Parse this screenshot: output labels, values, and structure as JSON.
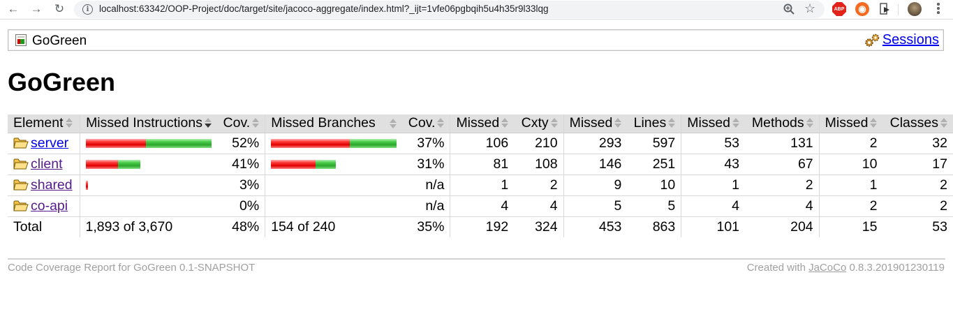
{
  "browser": {
    "url": "localhost:63342/OOP-Project/doc/target/site/jacoco-aggregate/index.html?_ijt=1vfe06pgbqih5u4h35r9l33lqg",
    "ext_abp": "ABP"
  },
  "breadcrumb": {
    "label": "GoGreen",
    "sessions_label": "Sessions"
  },
  "page": {
    "title": "GoGreen"
  },
  "table": {
    "headers": [
      "Element",
      "Missed Instructions",
      "Cov.",
      "Missed Branches",
      "Cov.",
      "Missed",
      "Cxty",
      "Missed",
      "Lines",
      "Missed",
      "Methods",
      "Missed",
      "Classes"
    ],
    "rows": [
      {
        "name": "server",
        "visited": false,
        "instr_missed": 0.4785,
        "instr_cov": "52%",
        "branch_missed": 0.625,
        "branch_cov": "37%",
        "cxty_missed": "106",
        "cxty": "210",
        "lines_missed": "293",
        "lines": "597",
        "methods_missed": "53",
        "methods": "131",
        "classes_missed": "2",
        "classes": "32",
        "instr_total_frac": 1.0,
        "branch_total_frac": 1.0
      },
      {
        "name": "client",
        "visited": true,
        "instr_missed": 0.587,
        "instr_cov": "41%",
        "branch_missed": 0.69,
        "branch_cov": "31%",
        "cxty_missed": "81",
        "cxty": "108",
        "lines_missed": "146",
        "lines": "251",
        "methods_missed": "43",
        "methods": "67",
        "classes_missed": "10",
        "classes": "17",
        "instr_total_frac": 0.434,
        "branch_total_frac": 0.515
      },
      {
        "name": "shared",
        "visited": true,
        "instr_missed": 0.97,
        "instr_cov": "3%",
        "branch_missed": null,
        "branch_cov": "n/a",
        "cxty_missed": "1",
        "cxty": "2",
        "lines_missed": "9",
        "lines": "10",
        "methods_missed": "1",
        "methods": "2",
        "classes_missed": "1",
        "classes": "2",
        "instr_total_frac": 0.018,
        "branch_total_frac": 0
      },
      {
        "name": "co-api",
        "visited": true,
        "instr_missed": 1.0,
        "instr_cov": "0%",
        "branch_missed": null,
        "branch_cov": "n/a",
        "cxty_missed": "4",
        "cxty": "4",
        "lines_missed": "5",
        "lines": "5",
        "methods_missed": "4",
        "methods": "4",
        "classes_missed": "2",
        "classes": "2",
        "instr_total_frac": 0.0,
        "branch_total_frac": 0
      }
    ],
    "total": {
      "label": "Total",
      "instr": "1,893 of 3,670",
      "instr_cov": "48%",
      "branch": "154 of 240",
      "branch_cov": "35%",
      "cxty_missed": "192",
      "cxty": "324",
      "lines_missed": "453",
      "lines": "863",
      "methods_missed": "101",
      "methods": "204",
      "classes_missed": "15",
      "classes": "53"
    }
  },
  "footer": {
    "left": "Code Coverage Report for GoGreen 0.1-SNAPSHOT",
    "right_prefix": "Created with",
    "right_link": "JaCoCo",
    "right_suffix": "0.8.3.201901230119"
  },
  "colors": {
    "missed": "#e00000",
    "covered": "#2aa52a",
    "link": "#0000ee",
    "visited": "#551a8b"
  }
}
